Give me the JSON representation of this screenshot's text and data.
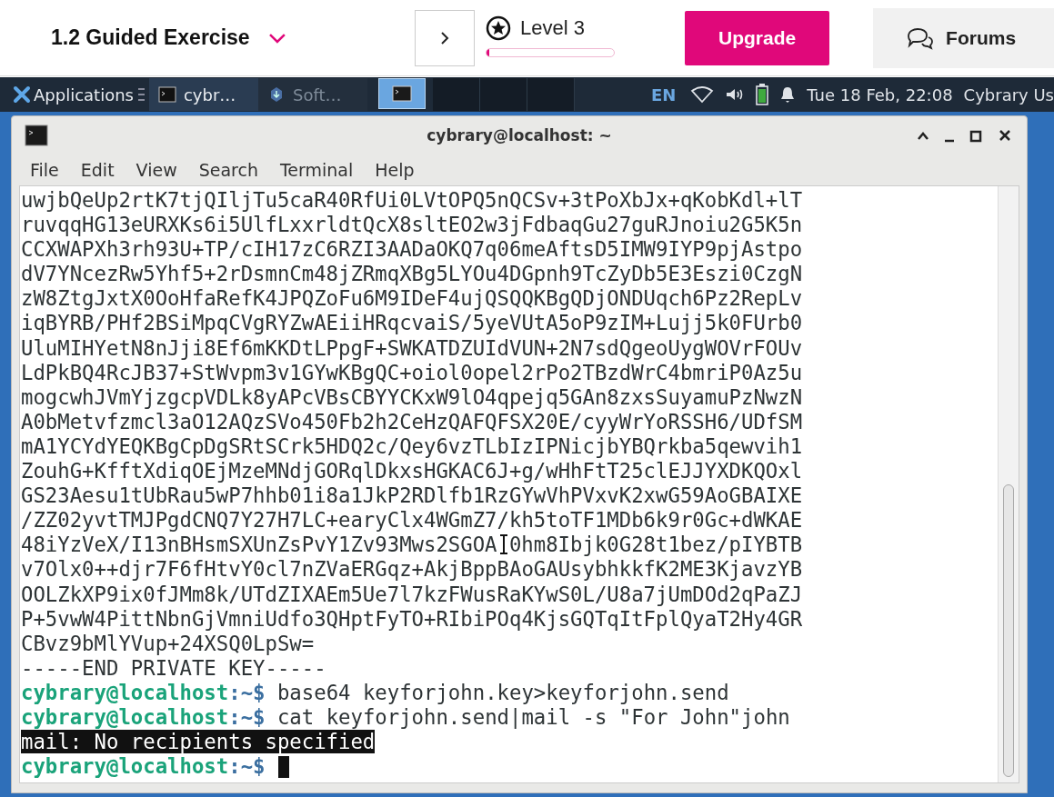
{
  "header": {
    "title": "1.2 Guided Exercise",
    "level_label": "Level 3",
    "progress": {
      "level": 0.02
    },
    "upgrade": "Upgrade",
    "forums": "Forums"
  },
  "taskbar": {
    "applications": "Applications",
    "tasks": [
      {
        "label": "cybr…",
        "selected": true
      },
      {
        "label": "Soft…",
        "selected": false
      }
    ],
    "workspaces": [
      {
        "selected": true
      },
      {
        "selected": false
      },
      {
        "selected": false
      },
      {
        "selected": false
      }
    ],
    "language": "EN",
    "clock": "Tue 18 Feb, 22:08",
    "user": "Cybrary Us"
  },
  "window": {
    "title": "cybrary@localhost: ~",
    "menu": [
      "File",
      "Edit",
      "View",
      "Search",
      "Terminal",
      "Help"
    ],
    "lines": [
      {
        "kind": "output",
        "text": "uwjbQeUp2rtK7tjQIljTu5caR40RfUi0LVtOPQ5nQCSv+3tPoXbJx+qKobKdl+lT"
      },
      {
        "kind": "output",
        "text": "ruvqqHG13eURXKs6i5UlfLxxrldtQcX8sltEO2w3jFdbaqGu27guRJnoiu2G5K5n"
      },
      {
        "kind": "output",
        "text": "CCXWAPXh3rh93U+TP/cIH17zC6RZI3AADaOKQ7q06meAftsD5IMW9IYP9pjAstpo"
      },
      {
        "kind": "output",
        "text": "dV7YNcezRw5Yhf5+2rDsmnCm48jZRmqXBg5LYOu4DGpnh9TcZyDb5E3Eszi0CzgN"
      },
      {
        "kind": "output",
        "text": "zW8ZtgJxtX0OoHfaRefK4JPQZoFu6M9IDeF4ujQSQQKBgQDjONDUqch6Pz2RepLv"
      },
      {
        "kind": "output",
        "text": "iqBYRB/PHf2BSiMpqCVgRYZwAEiiHRqcvaiS/5yeVUtA5oP9zIM+Lujj5k0FUrb0"
      },
      {
        "kind": "output",
        "text": "UluMIHYetN8nJji8Ef6mKKDtLPpgF+SWKATDZUIdVUN+2N7sdQgeoUygWOVrFOUv"
      },
      {
        "kind": "output",
        "text": "LdPkBQ4RcJB37+StWvpm3v1GYwKBgQC+oiol0opel2rPo2TBzdWrC4bmriP0Az5u"
      },
      {
        "kind": "output",
        "text": "mogcwhJVmYjzgcpVDLk8yAPcVBsCBYYCKxW9lO4qpejq5GAn8zxsSuyamuPzNwzN"
      },
      {
        "kind": "output",
        "text": "A0bMetvfzmcl3aO12AQzSVo450Fb2h2CeHzQAFQFSX20E/cyyWrYoRSSH6/UDfSM"
      },
      {
        "kind": "output",
        "text": "mA1YCYdYEQKBgCpDgSRtSCrk5HDQ2c/Qey6vzTLbIzIPNicjbYBQrkba5qewvih1"
      },
      {
        "kind": "output",
        "text": "ZouhG+KfftXdiqOEjMzeMNdjGORqlDkxsHGKAC6J+g/wHhFtT25clEJJYXDKQOxl"
      },
      {
        "kind": "output",
        "text": "GS23Aesu1tUbRau5wP7hhb01i8a1JkP2RDlfb1RzGYwVhPVxvK2xwG59AoGBAIXE"
      },
      {
        "kind": "output",
        "text": "/ZZ02yvtTMJPgdCNQ7Y27H7LC+earyClx4WGmZ7/kh5toTF1MDb6k9r0Gc+dWKAE"
      },
      {
        "kind": "output",
        "text": "48iYzVeX/I13nBHsmSXUnZsPvY1Zv93Mws2SGOA",
        "text_after": "0hm8Ibjk0G28t1bez/pIYBTB"
      },
      {
        "kind": "output",
        "text": "v7Olx0++djr7F6fHtvY0cl7nZVaERGqz+AkjBppBAoGAUsybhkkfK2ME3KjavzYB"
      },
      {
        "kind": "output",
        "text": "OOLZkXP9ix0fJMm8k/UTdZIXAEm5Ue7l7kzFWusRaKYwS0L/U8a7jUmDOd2qPaZJ"
      },
      {
        "kind": "output",
        "text": "P+5vwW4PittNbnGjVmniUdfo3QHptFyTO+RIbiPOq4KjsGQTqItFplQyaT2Hy4GR"
      },
      {
        "kind": "output",
        "text": "CBvz9bMlYVup+24XSQ0LpSw="
      },
      {
        "kind": "output",
        "text": "-----END PRIVATE KEY-----"
      },
      {
        "kind": "prompt",
        "user": "cybrary@localhost",
        "suffix": ":~$",
        "command": "base64 keyforjohn.key>keyforjohn.send",
        "cursor": false
      },
      {
        "kind": "prompt",
        "user": "cybrary@localhost",
        "suffix": ":~$",
        "command": "cat keyforjohn.send|mail -s \"For John\"john",
        "cursor": false
      },
      {
        "kind": "selected",
        "text": "mail: No recipients specified"
      },
      {
        "kind": "prompt",
        "user": "cybrary@localhost",
        "suffix": ":~$",
        "cursor": true
      }
    ]
  }
}
